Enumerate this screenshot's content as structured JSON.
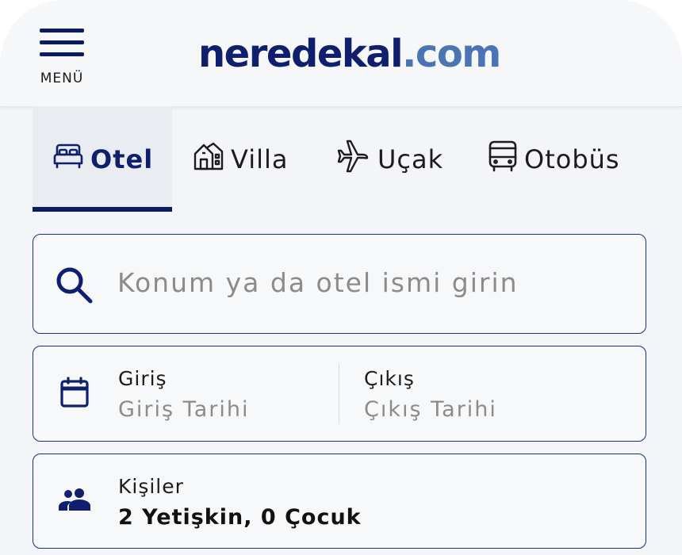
{
  "header": {
    "menu_label": "MENÜ",
    "logo_brand": "neredekal",
    "logo_tld": ".com",
    "brand_color": "#0f1f6e",
    "tld_color": "#4a74b4"
  },
  "tabs": [
    {
      "label": "Otel",
      "icon": "bed-icon",
      "active": true
    },
    {
      "label": "Villa",
      "icon": "villa-house-icon",
      "active": false
    },
    {
      "label": "Uçak",
      "icon": "airplane-icon",
      "active": false
    },
    {
      "label": "Otobüs",
      "icon": "bus-icon",
      "active": false
    }
  ],
  "search": {
    "placeholder": "Konum ya da otel ismi girin",
    "icon": "search-icon"
  },
  "dates": {
    "icon": "calendar-icon",
    "checkin": {
      "label": "Giriş",
      "placeholder": "Giriş Tarihi"
    },
    "checkout": {
      "label": "Çıkış",
      "placeholder": "Çıkış Tarihi"
    }
  },
  "guests": {
    "icon": "people-icon",
    "label": "Kişiler",
    "value": "2 Yetişkin, 0 Çocuk"
  },
  "colors": {
    "accent": "#0b1a63",
    "card_border": "#1a2f7a",
    "placeholder_text": "#8b8b8b"
  }
}
